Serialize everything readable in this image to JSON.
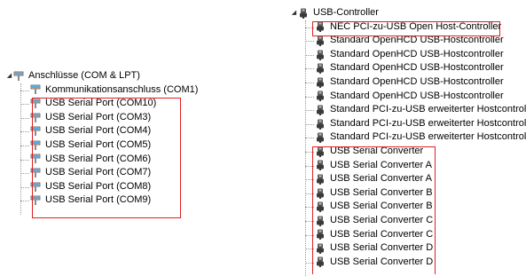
{
  "left_tree": {
    "category_label": "Anschlüsse (COM & LPT)",
    "category_icon": "serial-port-icon",
    "expander": "◢",
    "items": [
      {
        "label": "Kommunikationsanschluss (COM1)",
        "icon": "serial-port-icon"
      },
      {
        "label": "USB Serial Port (COM10)",
        "icon": "serial-port-icon"
      },
      {
        "label": "USB Serial Port (COM3)",
        "icon": "serial-port-icon"
      },
      {
        "label": "USB Serial Port (COM4)",
        "icon": "serial-port-icon"
      },
      {
        "label": "USB Serial Port (COM5)",
        "icon": "serial-port-icon"
      },
      {
        "label": "USB Serial Port (COM6)",
        "icon": "serial-port-icon"
      },
      {
        "label": "USB Serial Port (COM7)",
        "icon": "serial-port-icon"
      },
      {
        "label": "USB Serial Port (COM8)",
        "icon": "serial-port-icon"
      },
      {
        "label": "USB Serial Port (COM9)",
        "icon": "serial-port-icon"
      }
    ]
  },
  "right_tree": {
    "category_label": "USB-Controller",
    "category_icon": "usb-plug-icon",
    "expander": "◢",
    "items": [
      {
        "label": "NEC PCI-zu-USB Open Host-Controller",
        "icon": "usb-plug-icon"
      },
      {
        "label": "Standard OpenHCD USB-Hostcontroller",
        "icon": "usb-plug-icon"
      },
      {
        "label": "Standard OpenHCD USB-Hostcontroller",
        "icon": "usb-plug-icon"
      },
      {
        "label": "Standard OpenHCD USB-Hostcontroller",
        "icon": "usb-plug-icon"
      },
      {
        "label": "Standard OpenHCD USB-Hostcontroller",
        "icon": "usb-plug-icon"
      },
      {
        "label": "Standard OpenHCD USB-Hostcontroller",
        "icon": "usb-plug-icon"
      },
      {
        "label": "Standard PCI-zu-USB erweiterter Hostcontroller",
        "icon": "usb-plug-icon"
      },
      {
        "label": "Standard PCI-zu-USB erweiterter Hostcontroller",
        "icon": "usb-plug-icon"
      },
      {
        "label": "Standard PCI-zu-USB erweiterter Hostcontroller",
        "icon": "usb-plug-icon"
      },
      {
        "label": "USB Serial Converter",
        "icon": "usb-plug-icon"
      },
      {
        "label": "USB Serial Converter A",
        "icon": "usb-plug-icon"
      },
      {
        "label": "USB Serial Converter A",
        "icon": "usb-plug-icon"
      },
      {
        "label": "USB Serial Converter B",
        "icon": "usb-plug-icon"
      },
      {
        "label": "USB Serial Converter B",
        "icon": "usb-plug-icon"
      },
      {
        "label": "USB Serial Converter C",
        "icon": "usb-plug-icon"
      },
      {
        "label": "USB Serial Converter C",
        "icon": "usb-plug-icon"
      },
      {
        "label": "USB Serial Converter D",
        "icon": "usb-plug-icon"
      },
      {
        "label": "USB Serial Converter D",
        "icon": "usb-plug-icon"
      }
    ]
  },
  "colors": {
    "highlight_box": "#e02020",
    "tree_line": "#9a9a9a",
    "text": "#000000",
    "background": "#ffffff"
  }
}
